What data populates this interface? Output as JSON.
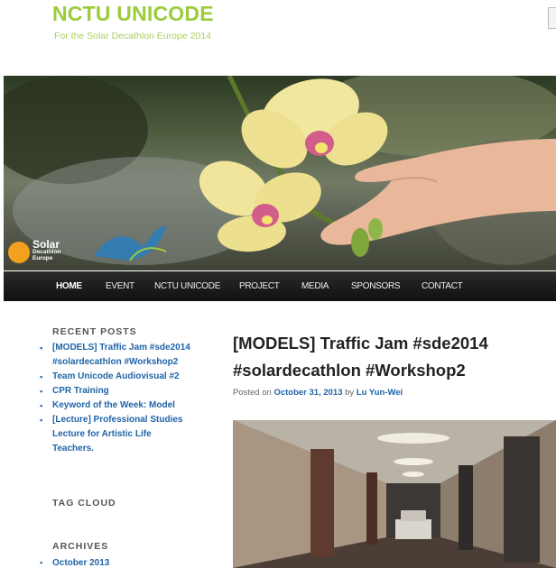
{
  "site": {
    "title": "NCTU UNICODE",
    "tagline": "For the Solar Decathlon Europe 2014"
  },
  "hero": {
    "logo_line1": "Solar",
    "logo_line2": "Decathlon",
    "logo_line3": "Europe",
    "colors": {
      "orange": "#f2a11f",
      "blue": "#2f7db8",
      "green": "#9ccb3b"
    }
  },
  "nav": {
    "items": [
      {
        "label": "HOME",
        "active": true
      },
      {
        "label": "EVENT",
        "active": false
      },
      {
        "label": "NCTU UNICODE",
        "active": false
      },
      {
        "label": "PROJECT",
        "active": false
      },
      {
        "label": "MEDIA",
        "active": false
      },
      {
        "label": "SPONSORS",
        "active": false
      },
      {
        "label": "CONTACT",
        "active": false
      }
    ]
  },
  "sidebar": {
    "recent_title": "RECENT POSTS",
    "recent_posts": [
      "[MODELS] Traffic Jam #sde2014 #solardecathlon #Workshop2",
      "Team Unicode Audiovisual #2",
      "CPR Training",
      "Keyword of the Week: Model",
      "[Lecture] Professional Studies Lecture for Artistic Life Teachers."
    ],
    "tagcloud_title": "TAG CLOUD",
    "archives_title": "ARCHIVES",
    "archives": [
      "October 2013"
    ]
  },
  "post": {
    "title": "[MODELS] Traffic Jam #sde2014 #solardecathlon #Workshop2",
    "posted_on": "Posted on",
    "date": "October 31, 2013",
    "by": "by",
    "author": "Lu Yun-Wei"
  },
  "colors": {
    "brand_green": "#9ccb3b",
    "link_blue": "#1f64a8",
    "nav_bg": "#1a1a1a"
  }
}
